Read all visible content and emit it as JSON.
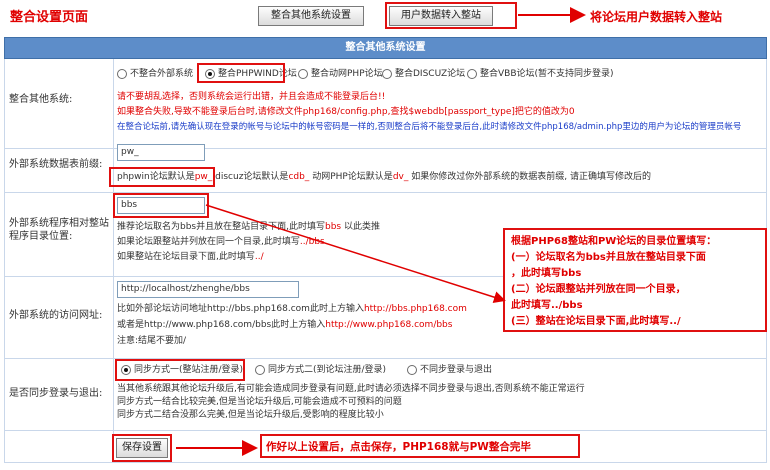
{
  "annotations": {
    "page_title": "整合设置页面",
    "import_note": "将论坛用户数据转入整站",
    "dir_box": {
      "line1": "根据PHP68整站和PW论坛的目录位置填写：",
      "line2": "(一）论坛取名为bbs并且放在整站目录下面",
      "line3": "，此时填写bbs",
      "line4": "(二）论坛跟整站并列放在同一个目录，",
      "line5": "此时填写../bbs",
      "line6": "(三）整站在论坛目录下面,此时填写../"
    },
    "save_note": "作好以上设置后，点击保存，PHP168就与PW整合完毕"
  },
  "top_buttons": {
    "integrate_settings": "整合其他系统设置",
    "import_users": "用户数据转入整站"
  },
  "panel_title": "整合其他系统设置",
  "sections": {
    "integrate": {
      "label": "整合其他系统:",
      "options": [
        {
          "label": "不整合外部系统",
          "selected": false
        },
        {
          "label": "整合PHPWIND论坛",
          "selected": true
        },
        {
          "label": "整合动网PHP论坛",
          "selected": false
        },
        {
          "label": "整合DISCUZ论坛",
          "selected": false
        },
        {
          "label": "整合VBB论坛(暂不支持同步登录)",
          "selected": false
        }
      ],
      "note1": "请不要胡乱选择，否则系统会运行出错，并且会造成不能登录后台!!",
      "note2": "如果整合失败,导致不能登录后台时,请修改文件php168/config.php,查找$webdb[passport_type]把它的值改为0",
      "note3": "在整合论坛前,请先确认现在登录的帐号与论坛中的帐号密码是一样的,否则整合后将不能登录后台,此时请修改文件php168/admin.php里边的用户为论坛的管理员帐号"
    },
    "prefix": {
      "label": "外部系统数据表前缀:",
      "value": "pw_",
      "hint_phpwind": "phpwin论坛默认是",
      "hint_pw": "pw_",
      "hint_discuz": "discuz论坛默认是",
      "hint_cdb": "cdb_",
      "hint_dvbbs": "动网PHP论坛默认是",
      "hint_dv": "dv_",
      "hint_tail": "如果你修改过你外部系统的数据表前缀, 请正确填写修改后的"
    },
    "dirpath": {
      "label": "外部系统程序相对整站程序目录位置:",
      "value": "bbs",
      "hint1a": "推荐论坛取名为bbs并且放在整站目录下面,此时填写",
      "hint1b": "bbs",
      "hint1c": "以此类推",
      "hint2a": "如果论坛跟整站并列放在同一个目录,此时填写",
      "hint2b": "../bbs",
      "hint3a": "如果整站在论坛目录下面,此时填写",
      "hint3b": "../"
    },
    "url": {
      "label": "外部系统的访问网址:",
      "value": "http://localhost/zhenghe/bbs",
      "hint1a": "比如外部论坛访问地址http://bbs.php168.com此时上方输入",
      "hint1b": "http://bbs.php168.com",
      "hint2a": "或者是http://www.php168.com/bbs此时上方输入",
      "hint2b": "http://www.php168.com/bbs",
      "hint3": "注意:结尾不要加/"
    },
    "sync": {
      "label": "是否同步登录与退出:",
      "options": [
        {
          "label": "同步方式一(整站注册/登录)",
          "selected": true
        },
        {
          "label": "同步方式二(到论坛注册/登录)",
          "selected": false
        },
        {
          "label": "不同步登录与退出",
          "selected": false
        }
      ],
      "note1": "当其他系统跟其他论坛升级后,有可能会造成同步登录有问题,此时请必须选择不同步登录与退出,否则系统不能正常运行",
      "note2": "同步方式一结合比较完美,但是当论坛升级后,可能会造成不可预料的问题",
      "note3": "同步方式二结合没那么完美,但是当论坛升级后,受影响的程度比较小"
    }
  },
  "save_button": "保存设置",
  "colors": {
    "accent": "#5d8dc9",
    "annotation": "#e00000",
    "link": "#1a3cc8"
  }
}
